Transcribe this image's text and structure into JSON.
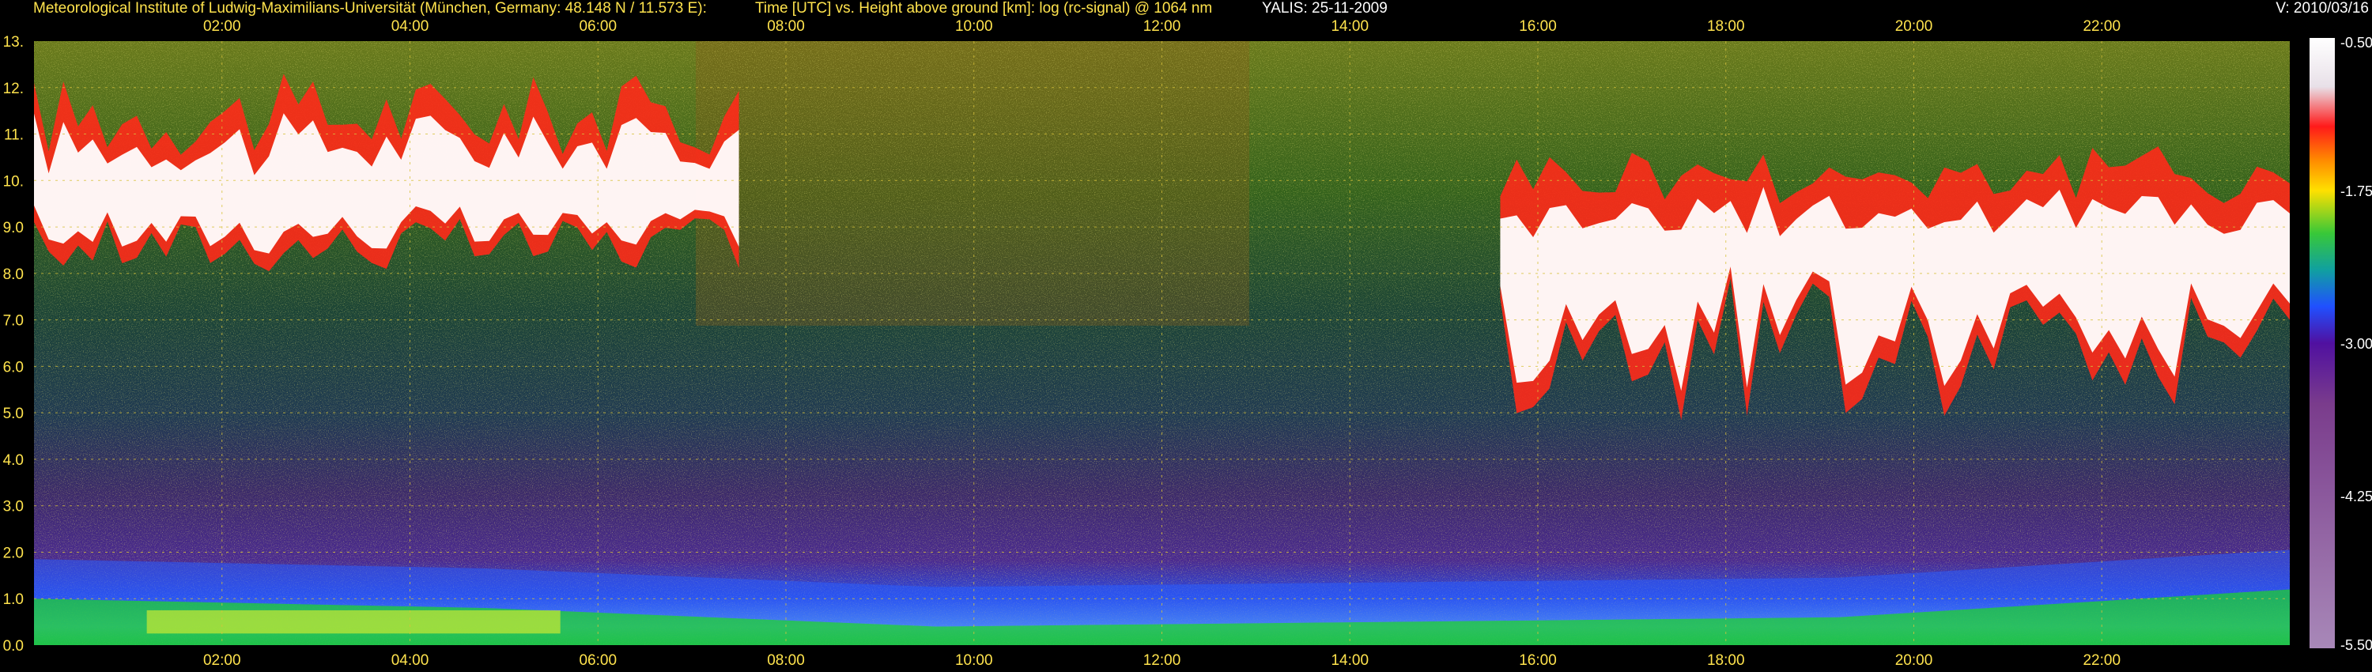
{
  "header": {
    "institute": "Meteorological Institute of Ludwig-Maximilians-Universität (München, Germany: 48.148 N / 11.573 E):",
    "axes_description": "Time [UTC] vs. Height above ground [km]: log (rc-signal) @ 1064 nm",
    "instrument_date": "YALIS: 25-11-2009",
    "version": "V: 2010/03/16"
  },
  "colors": {
    "background": "#000000",
    "header_text": "#ffe34d",
    "grid": "#d8c23a",
    "colormap": [
      "#ffffff",
      "#e8e0e8",
      "#ff1a1a",
      "#ff8a00",
      "#ffe000",
      "#38c838",
      "#10a0a0",
      "#2050ff",
      "#5010a0",
      "#7a3c8c",
      "#a888b8"
    ]
  },
  "chart_data": {
    "type": "heatmap",
    "title": "Time [UTC] vs. Height above ground [km]: log (rc-signal) @ 1064 nm",
    "x": {
      "unit": "UTC",
      "range": [
        "00:00",
        "24:00"
      ],
      "ticks": [
        "02:00",
        "04:00",
        "06:00",
        "08:00",
        "10:00",
        "12:00",
        "14:00",
        "16:00",
        "18:00",
        "20:00",
        "22:00"
      ],
      "tick_hours": [
        2,
        4,
        6,
        8,
        10,
        12,
        14,
        16,
        18,
        20,
        22
      ]
    },
    "y": {
      "unit": "km",
      "range": [
        0,
        13
      ],
      "ticks": [
        "0.0",
        "1.0",
        "2.0",
        "3.0",
        "4.0",
        "5.0",
        "6.0",
        "7.0",
        "8.0",
        "9.0",
        "10.",
        "11.",
        "12.",
        "13."
      ],
      "tick_values": [
        0,
        1,
        2,
        3,
        4,
        5,
        6,
        7,
        8,
        9,
        10,
        11,
        12,
        13
      ]
    },
    "colorbar": {
      "range": [
        -5.5,
        -0.5
      ],
      "ticks": [
        "-0.50",
        "-1.75",
        "-3.00",
        "-4.25",
        "-5.50"
      ],
      "tick_values": [
        -0.5,
        -1.75,
        -3.0,
        -4.25,
        -5.5
      ]
    },
    "grid": true,
    "features": {
      "cloud_layers": [
        {
          "start_hour": 0.0,
          "end_hour": 7.5,
          "base_km": [
            8.0,
            9.2
          ],
          "top_km": [
            10.5,
            12.3
          ]
        },
        {
          "start_hour": 15.6,
          "end_hour": 24.0,
          "base_km": [
            4.8,
            8.0
          ],
          "top_km": [
            9.5,
            10.8
          ]
        }
      ],
      "boundary_layer_top_km": [
        1.0,
        0.8,
        0.4,
        0.5,
        0.6,
        1.2
      ]
    }
  }
}
